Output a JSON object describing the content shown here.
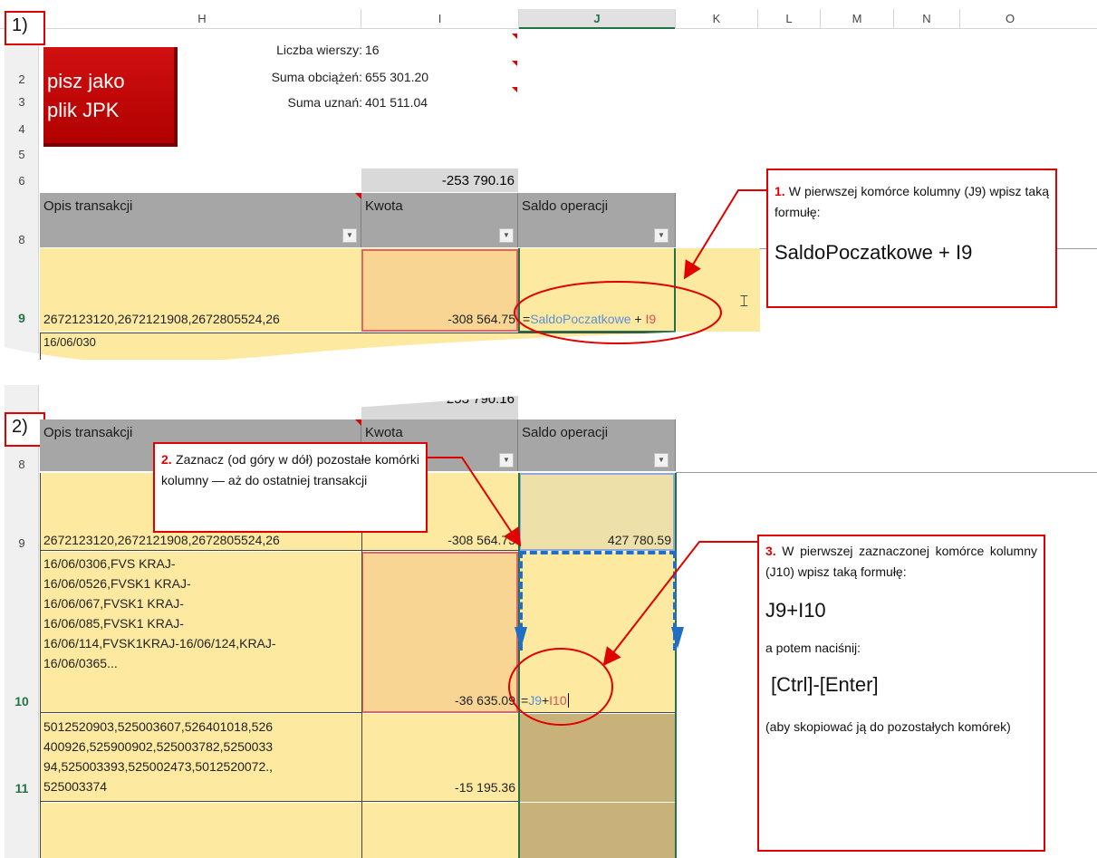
{
  "columns": [
    "H",
    "I",
    "J",
    "K",
    "L",
    "M",
    "N",
    "O"
  ],
  "step1_label": "1)",
  "step2_label": "2)",
  "macro_button": {
    "line1": "pisz jako",
    "line2": "plik JPK"
  },
  "summary": {
    "rows_label": "Liczba wierszy:",
    "rows_value": "16",
    "debit_label": "Suma obciążeń:",
    "debit_value": "655 301.20",
    "credit_label": "Suma uznań:",
    "credit_value": "401 511.04"
  },
  "row_numbers_top": [
    "2",
    "3",
    "4",
    "5",
    "6",
    "8",
    "9"
  ],
  "row_numbers_bottom": [
    "8",
    "9",
    "10",
    "11"
  ],
  "total_value": "-253 790.16",
  "total_value_cut": "-253 790.16",
  "table_headers": {
    "desc": "Opis transakcji",
    "amount": "Kwota",
    "balance": "Saldo operacji"
  },
  "row9": {
    "desc": "2672123120,2672121908,2672805524,26",
    "amount": "-308 564.75",
    "balance": "427 780.59"
  },
  "row9_partial": "16/06/030",
  "formula1": {
    "eq": "=",
    "name": "SaldoPoczatkowe",
    "plus": " + ",
    "ref": "I9"
  },
  "row10": {
    "lines": [
      "16/06/0306,FVS KRAJ-",
      "16/06/0526,FVSK1 KRAJ-",
      "16/06/067,FVSK1 KRAJ-",
      "16/06/085,FVSK1 KRAJ-",
      "16/06/114,FVSK1KRAJ-16/06/124,KRAJ-",
      "16/06/0365..."
    ],
    "amount": "-36 635.09"
  },
  "formula2": {
    "eq": "=",
    "ref1": "J9",
    "plus": "+",
    "ref2": "I10"
  },
  "row11": {
    "lines": [
      "5012520903,525003607,526401018,526",
      "400926,525900902,525003782,5250033",
      "94,525003393,525002473,5012520072.,",
      "525003374"
    ],
    "amount": "-15 195.36"
  },
  "callout1": {
    "num": "1.",
    "text": " W pierwszej komórce kolumny (J9) wpisz taką formułę:",
    "formula": "SaldoPoczatkowe + I9"
  },
  "callout2": {
    "num": "2.",
    "text": " Zaznacz (od góry w dół) pozostałe komórki kolumny — aż do ostatniej transakcji"
  },
  "callout3": {
    "num": "3.",
    "text": " W pierwszej zaznaczonej komórce kolumny (J10) wpisz taką formułę:",
    "formula": "J9+I10",
    "then": "a potem naciśnij:",
    "keys": "[Ctrl]-[Enter]",
    "note": "(aby skopiować ją do pozostałych komórek)"
  },
  "colors": {
    "accent": "#e00000",
    "cell_yellow": "#fde9a0",
    "header_gray": "#a6a6a6",
    "formula_blue": "#5b8fd9",
    "formula_red": "#e05050"
  }
}
